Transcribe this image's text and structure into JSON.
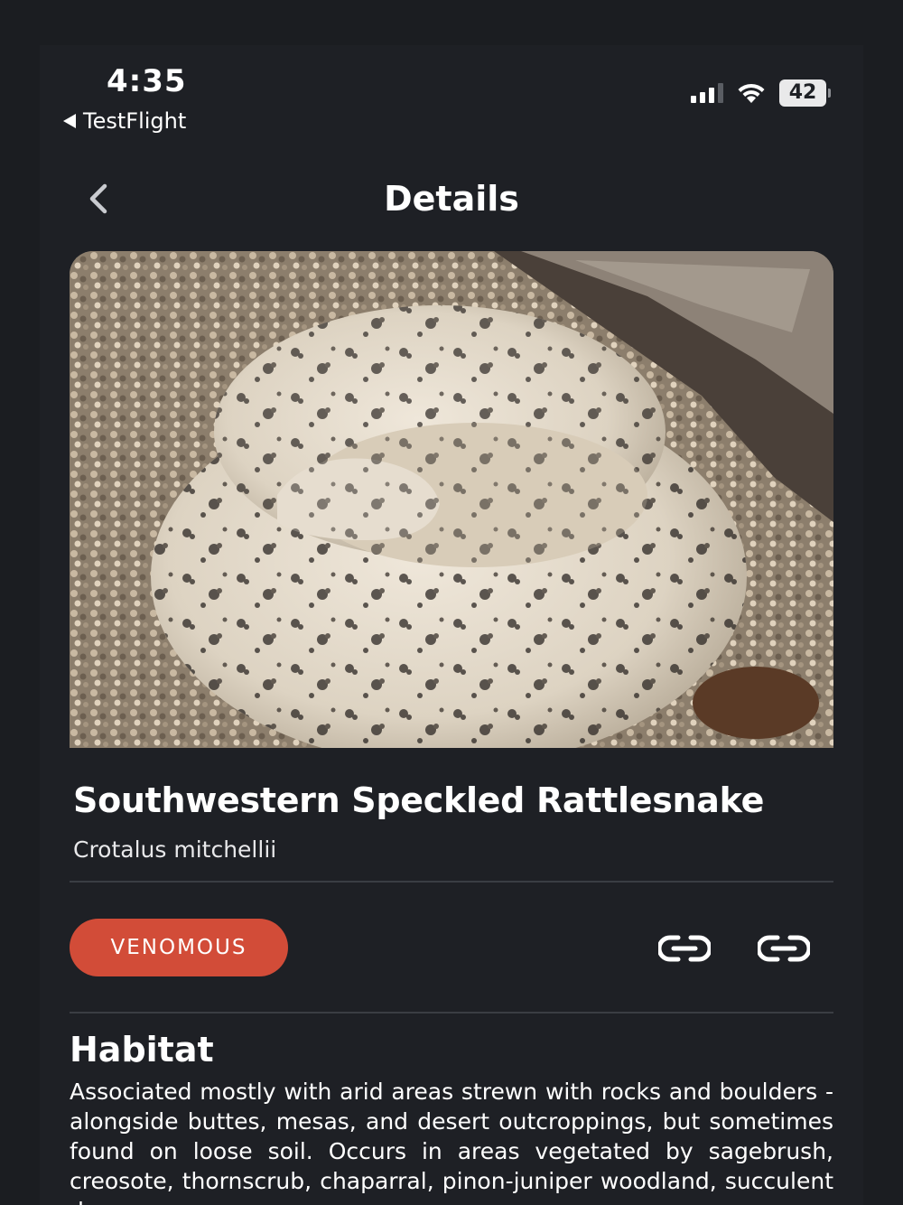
{
  "status_bar": {
    "time": "4:35",
    "back_app": "TestFlight",
    "battery": "42",
    "icons": [
      "cellular-signal-icon",
      "wifi-icon",
      "battery-icon"
    ]
  },
  "nav": {
    "title": "Details",
    "back_icon": "chevron-left-icon"
  },
  "species": {
    "common_name": "Southwestern Speckled Rattlesnake",
    "scientific_name": "Crotalus mitchellii",
    "badge": "VENOMOUS",
    "badge_color": "#d24c38",
    "action_icons": [
      "link-icon",
      "link-icon"
    ]
  },
  "habitat": {
    "title": "Habitat",
    "text": "Associated mostly with arid areas strewn with rocks and boulders - alongside buttes, mesas, and desert outcroppings, but sometimes found on loose soil. Occurs in areas vegetated by sagebrush, creosote, thornscrub, chaparral, pinon-juniper woodland, succulent d"
  },
  "colors": {
    "background": "#1e2025",
    "text": "#ffffff",
    "divider": "#3a3d43"
  }
}
